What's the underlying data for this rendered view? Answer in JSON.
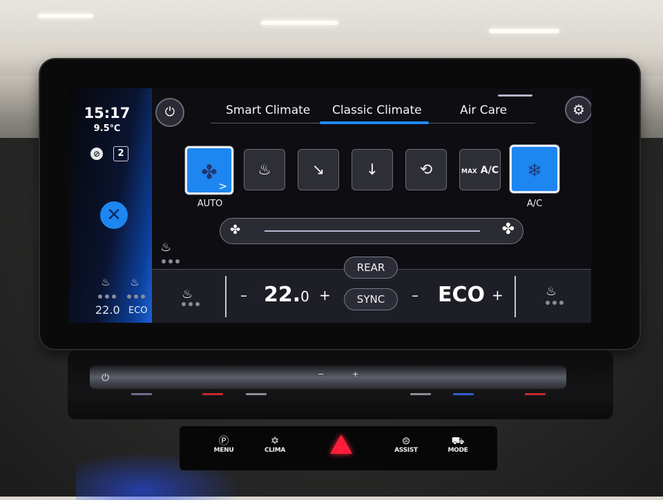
{
  "status": {
    "time": "15:17",
    "outside_temp": "9.5℃",
    "recirc_icon": "recirculation-off-icon",
    "badge_count": "2"
  },
  "sidebar": {
    "close_icon": "✕",
    "driver_seat": {
      "icon": "seat-heat-icon",
      "value": "22.0",
      "level_dots": 3
    },
    "passenger_seat": {
      "icon": "seat-vent-icon",
      "value": "ECO",
      "level_dots": 3
    }
  },
  "header": {
    "power_icon": "⏻",
    "settings_icon": "⚙",
    "tabs": [
      {
        "label": "Smart Climate",
        "active": false
      },
      {
        "label": "Classic Climate",
        "active": true
      },
      {
        "label": "Air Care",
        "active": false
      }
    ]
  },
  "modes": [
    {
      "name": "auto",
      "icon": "fan-icon",
      "glyph": "✤",
      "label": "AUTO",
      "active": true,
      "has_more": ">"
    },
    {
      "name": "windshield-defrost",
      "icon": "windshield-defrost-icon",
      "glyph": "♨",
      "label": "",
      "active": false
    },
    {
      "name": "airflow-upper",
      "icon": "airflow-upper-body-icon",
      "glyph": "↘",
      "label": "",
      "active": false
    },
    {
      "name": "airflow-feet",
      "icon": "airflow-feet-icon",
      "glyph": "↓",
      "label": "",
      "active": false
    },
    {
      "name": "recirculation",
      "icon": "car-recirculation-icon",
      "glyph": "⟲",
      "label": "",
      "active": false
    },
    {
      "name": "max-ac",
      "icon": "max-ac-icon",
      "glyph_small": "MAX",
      "glyph": "A/C",
      "label": "",
      "active": false
    },
    {
      "name": "ac",
      "icon": "snowflake-icon",
      "glyph": "❄",
      "label": "A/C",
      "active": true
    }
  ],
  "fan": {
    "min_icon": "✤",
    "max_icon": "✤",
    "level_percent": 100
  },
  "rear_seat": {
    "icon": "rear-seat-heat-icon",
    "glyph": "♨",
    "level_dots": 3
  },
  "controls": {
    "rear_label": "REAR",
    "sync_label": "SYNC",
    "driver": {
      "minus": "–",
      "value": "22.",
      "decimal": "0",
      "plus": "+",
      "seat_glyph": "♨"
    },
    "passenger": {
      "minus": "–",
      "value": "ECO",
      "plus": "+",
      "seat_glyph": "♨"
    }
  },
  "hardware": {
    "power_glyph": "⏻",
    "vol_minus": "−",
    "vol_plus": "+",
    "indicator_colors": [
      "#6d6f8c",
      "#c8282c",
      "#8e8e92",
      "#8e8e92",
      "#2e5fc8",
      "#c8282c"
    ],
    "buttons": [
      {
        "name": "menu",
        "glyph": "Ⓟ",
        "label": "MENU"
      },
      {
        "name": "clima",
        "glyph": "✡",
        "label": "CLIMA"
      },
      {
        "name": "assist",
        "glyph": "⊜",
        "label": "ASSIST"
      },
      {
        "name": "mode",
        "glyph": "⛟",
        "label": "MODE"
      }
    ],
    "hazard_color": "#ff1d3b"
  }
}
